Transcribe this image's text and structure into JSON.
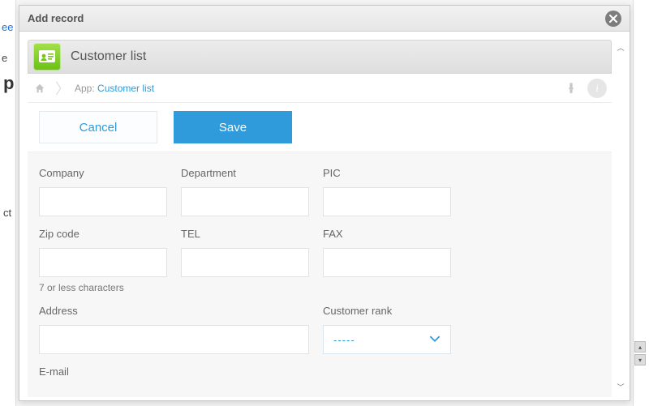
{
  "modal": {
    "title": "Add record"
  },
  "app": {
    "name": "Customer list"
  },
  "breadcrumb": {
    "label": "App:",
    "link": "Customer list"
  },
  "actions": {
    "cancel": "Cancel",
    "save": "Save"
  },
  "fields": {
    "company": {
      "label": "Company",
      "value": ""
    },
    "department": {
      "label": "Department",
      "value": ""
    },
    "pic": {
      "label": "PIC",
      "value": ""
    },
    "zip": {
      "label": "Zip code",
      "value": "",
      "hint": "7 or less characters"
    },
    "tel": {
      "label": "TEL",
      "value": ""
    },
    "fax": {
      "label": "FAX",
      "value": ""
    },
    "address": {
      "label": "Address",
      "value": ""
    },
    "rank": {
      "label": "Customer rank",
      "selected": "-----"
    },
    "email": {
      "label": "E-mail",
      "value": ""
    }
  },
  "bg": {
    "p": "p",
    "ct": "ct",
    "ee": "ee"
  }
}
